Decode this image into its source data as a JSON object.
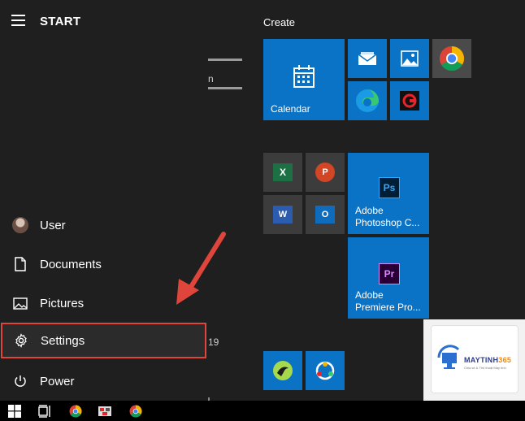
{
  "header": {
    "title": "START",
    "menu_icon": "hamburger-icon"
  },
  "rail": [
    {
      "key": "user",
      "label": "User",
      "icon": "user-avatar"
    },
    {
      "key": "documents",
      "label": "Documents",
      "icon": "document-icon"
    },
    {
      "key": "pictures",
      "label": "Pictures",
      "icon": "pictures-icon"
    },
    {
      "key": "settings",
      "label": "Settings",
      "icon": "gear-icon",
      "highlighted": true
    },
    {
      "key": "power",
      "label": "Power",
      "icon": "power-icon"
    }
  ],
  "applist_fragments": {
    "letter_n": "n",
    "number": "19"
  },
  "tiles": {
    "group_label": "Create",
    "calendar": "Calendar",
    "photoshop": "Adobe\nPhotoshop C...",
    "photoshop_line1": "Adobe",
    "photoshop_line2": "Photoshop C...",
    "premiere_line1": "Adobe",
    "premiere_line2": "Premiere Pro...",
    "ps_letters": "Ps",
    "pr_letters": "Pr",
    "excel_letter": "X",
    "word_letter": "W",
    "powerpoint_letter": "P",
    "outlook_letter": "O"
  },
  "watermark": {
    "brand_a": "MAYTINH",
    "brand_b": "365",
    "tagline": "Chia sẻ & Thủ thuật Máy tính"
  },
  "colors": {
    "accent_blue": "#0a73c6",
    "highlight_red": "#e0453c",
    "menu_bg": "#1f1f1f"
  }
}
